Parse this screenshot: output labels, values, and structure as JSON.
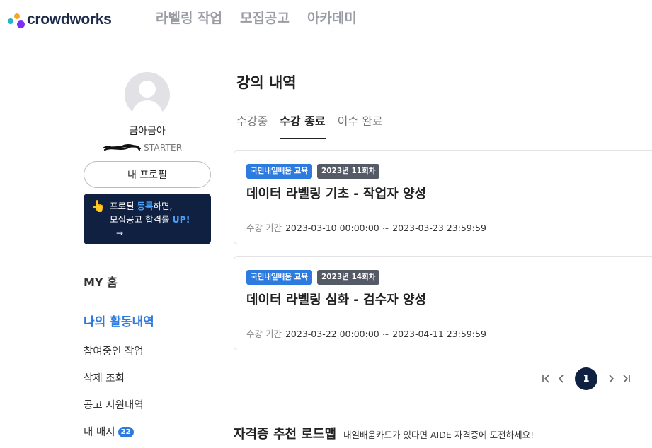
{
  "header": {
    "logo_text": "crowdworks",
    "nav": [
      "라벨링 작업",
      "모집공고",
      "아카데미"
    ]
  },
  "profile": {
    "username": "금아금아",
    "grade": "STARTER",
    "profile_button": "내 프로필",
    "promo": {
      "icon": "pointing-hand-icon",
      "line1_a": "프로필 ",
      "line1_b": "등록",
      "line1_c": "하면,",
      "line2_a": "모집공고 합격률 ",
      "line2_b": "UP!",
      "arrow": "→"
    }
  },
  "sidebar": {
    "my_home": "MY 홈",
    "section_title": "나의 활동내역",
    "links": [
      "참여중인 작업",
      "삭제 조회",
      "공고 지원내역",
      "내 배지"
    ],
    "badge_count": "22"
  },
  "main": {
    "title": "강의 내역",
    "tabs": [
      "수강중",
      "수강 종료",
      "이수 완료"
    ],
    "active_tab": "수강 종료",
    "period_label": "수강 기간",
    "courses": [
      {
        "chip1": "국민내일배움 교육",
        "chip2": "2023년 11회차",
        "title": "데이터 라벨링 기초 - 작업자 양성",
        "period": "2023-03-10 00:00:00 ~ 2023-03-23 23:59:59"
      },
      {
        "chip1": "국민내일배움 교육",
        "chip2": "2023년 14회차",
        "title": "데이터 라벨링 심화 - 검수자 양성",
        "period": "2023-03-22 00:00:00 ~ 2023-04-11 23:59:59"
      }
    ],
    "pagination": {
      "current": "1"
    }
  },
  "roadmap": {
    "title": "자격증 추천 로드맵",
    "subtitle": "내일배움카드가 있다면 AIDE 자격증에 도전하세요!"
  },
  "colors": {
    "accent": "#2e7be0",
    "navy": "#0f2040",
    "chip_gray": "#545a66"
  }
}
